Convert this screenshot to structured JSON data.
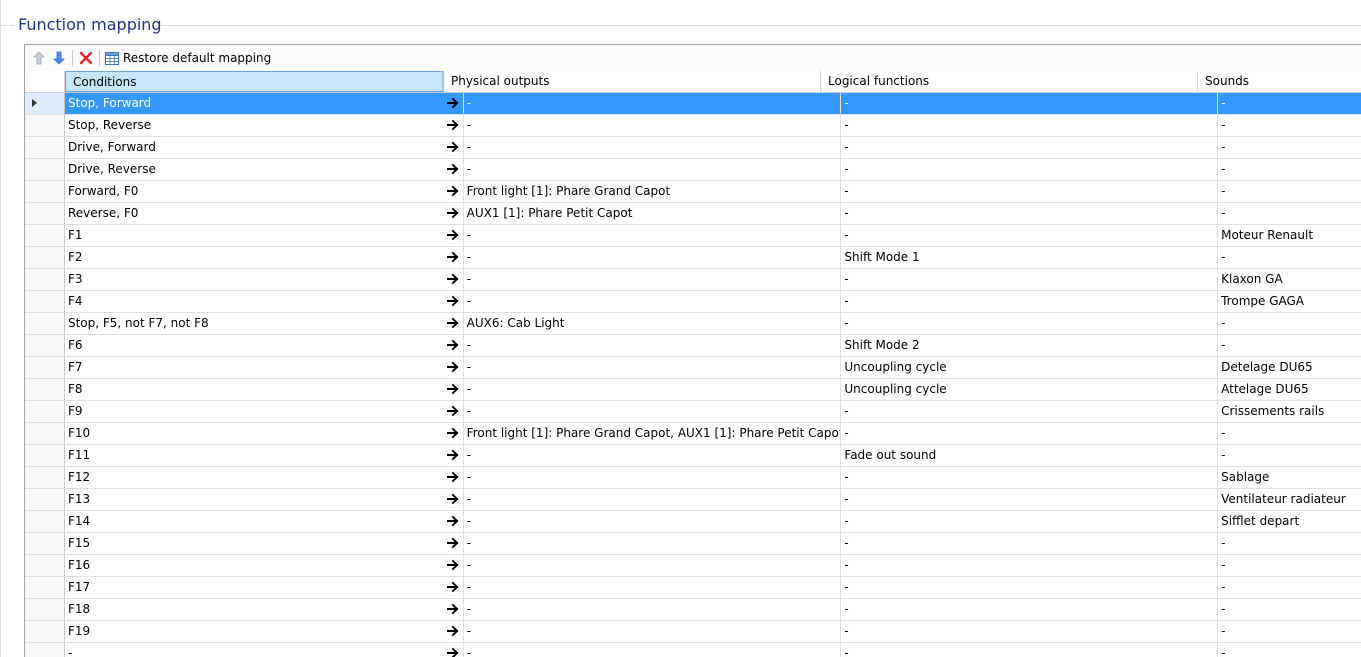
{
  "group": {
    "title": "Function mapping"
  },
  "toolbar": {
    "restore_label": "Restore default mapping"
  },
  "columns": {
    "conditions": "Conditions",
    "physical": "Physical outputs",
    "logical": "Logical functions",
    "sounds": "Sounds"
  },
  "colors": {
    "selection": "#3399ff",
    "header_active": "#c7e5f8",
    "title": "#1e3287",
    "delete": "#e02424",
    "arrow_up": "#9aa4b0",
    "arrow_down": "#2d6fd2"
  },
  "icons": {
    "move_up": "arrow-up-icon",
    "move_down": "arrow-down-icon",
    "delete": "delete-x-icon",
    "restore": "table-grid-icon",
    "row_arrow": "right-arrow-icon",
    "row_indicator": "row-pointer-icon"
  },
  "rows": [
    {
      "conditions": "Stop, Forward",
      "physical": "-",
      "logical": "-",
      "sounds": "-"
    },
    {
      "conditions": "Stop, Reverse",
      "physical": "-",
      "logical": "-",
      "sounds": "-"
    },
    {
      "conditions": "Drive, Forward",
      "physical": "-",
      "logical": "-",
      "sounds": "-"
    },
    {
      "conditions": "Drive, Reverse",
      "physical": "-",
      "logical": "-",
      "sounds": "-"
    },
    {
      "conditions": "Forward, F0",
      "physical": "Front light [1]: Phare Grand Capot",
      "logical": "-",
      "sounds": "-"
    },
    {
      "conditions": "Reverse, F0",
      "physical": "AUX1 [1]: Phare Petit Capot",
      "logical": "-",
      "sounds": "-"
    },
    {
      "conditions": "F1",
      "physical": "-",
      "logical": "-",
      "sounds": "Moteur Renault"
    },
    {
      "conditions": "F2",
      "physical": "-",
      "logical": "Shift Mode 1",
      "sounds": "-"
    },
    {
      "conditions": "F3",
      "physical": "-",
      "logical": "-",
      "sounds": "Klaxon GA"
    },
    {
      "conditions": "F4",
      "physical": "-",
      "logical": "-",
      "sounds": "Trompe GAGA"
    },
    {
      "conditions": "Stop, F5, not F7, not F8",
      "physical": "AUX6: Cab Light",
      "logical": "-",
      "sounds": "-"
    },
    {
      "conditions": "F6",
      "physical": "-",
      "logical": "Shift Mode 2",
      "sounds": "-"
    },
    {
      "conditions": "F7",
      "physical": "-",
      "logical": "Uncoupling cycle",
      "sounds": "Detelage DU65"
    },
    {
      "conditions": "F8",
      "physical": "-",
      "logical": "Uncoupling cycle",
      "sounds": "Attelage DU65"
    },
    {
      "conditions": "F9",
      "physical": "-",
      "logical": "-",
      "sounds": "Crissements rails"
    },
    {
      "conditions": "F10",
      "physical": "Front light [1]: Phare Grand Capot, AUX1 [1]: Phare Petit Capot",
      "logical": "-",
      "sounds": "-"
    },
    {
      "conditions": "F11",
      "physical": "-",
      "logical": "Fade out sound",
      "sounds": "-"
    },
    {
      "conditions": "F12",
      "physical": "-",
      "logical": "-",
      "sounds": "Sablage"
    },
    {
      "conditions": "F13",
      "physical": "-",
      "logical": "-",
      "sounds": "Ventilateur radiateur"
    },
    {
      "conditions": "F14",
      "physical": "-",
      "logical": "-",
      "sounds": "Sifflet depart"
    },
    {
      "conditions": "F15",
      "physical": "-",
      "logical": "-",
      "sounds": "-"
    },
    {
      "conditions": "F16",
      "physical": "-",
      "logical": "-",
      "sounds": "-"
    },
    {
      "conditions": "F17",
      "physical": "-",
      "logical": "-",
      "sounds": "-"
    },
    {
      "conditions": "F18",
      "physical": "-",
      "logical": "-",
      "sounds": "-"
    },
    {
      "conditions": "F19",
      "physical": "-",
      "logical": "-",
      "sounds": "-"
    },
    {
      "conditions": "-",
      "physical": "-",
      "logical": "-",
      "sounds": "-"
    }
  ],
  "selected_row": 0
}
